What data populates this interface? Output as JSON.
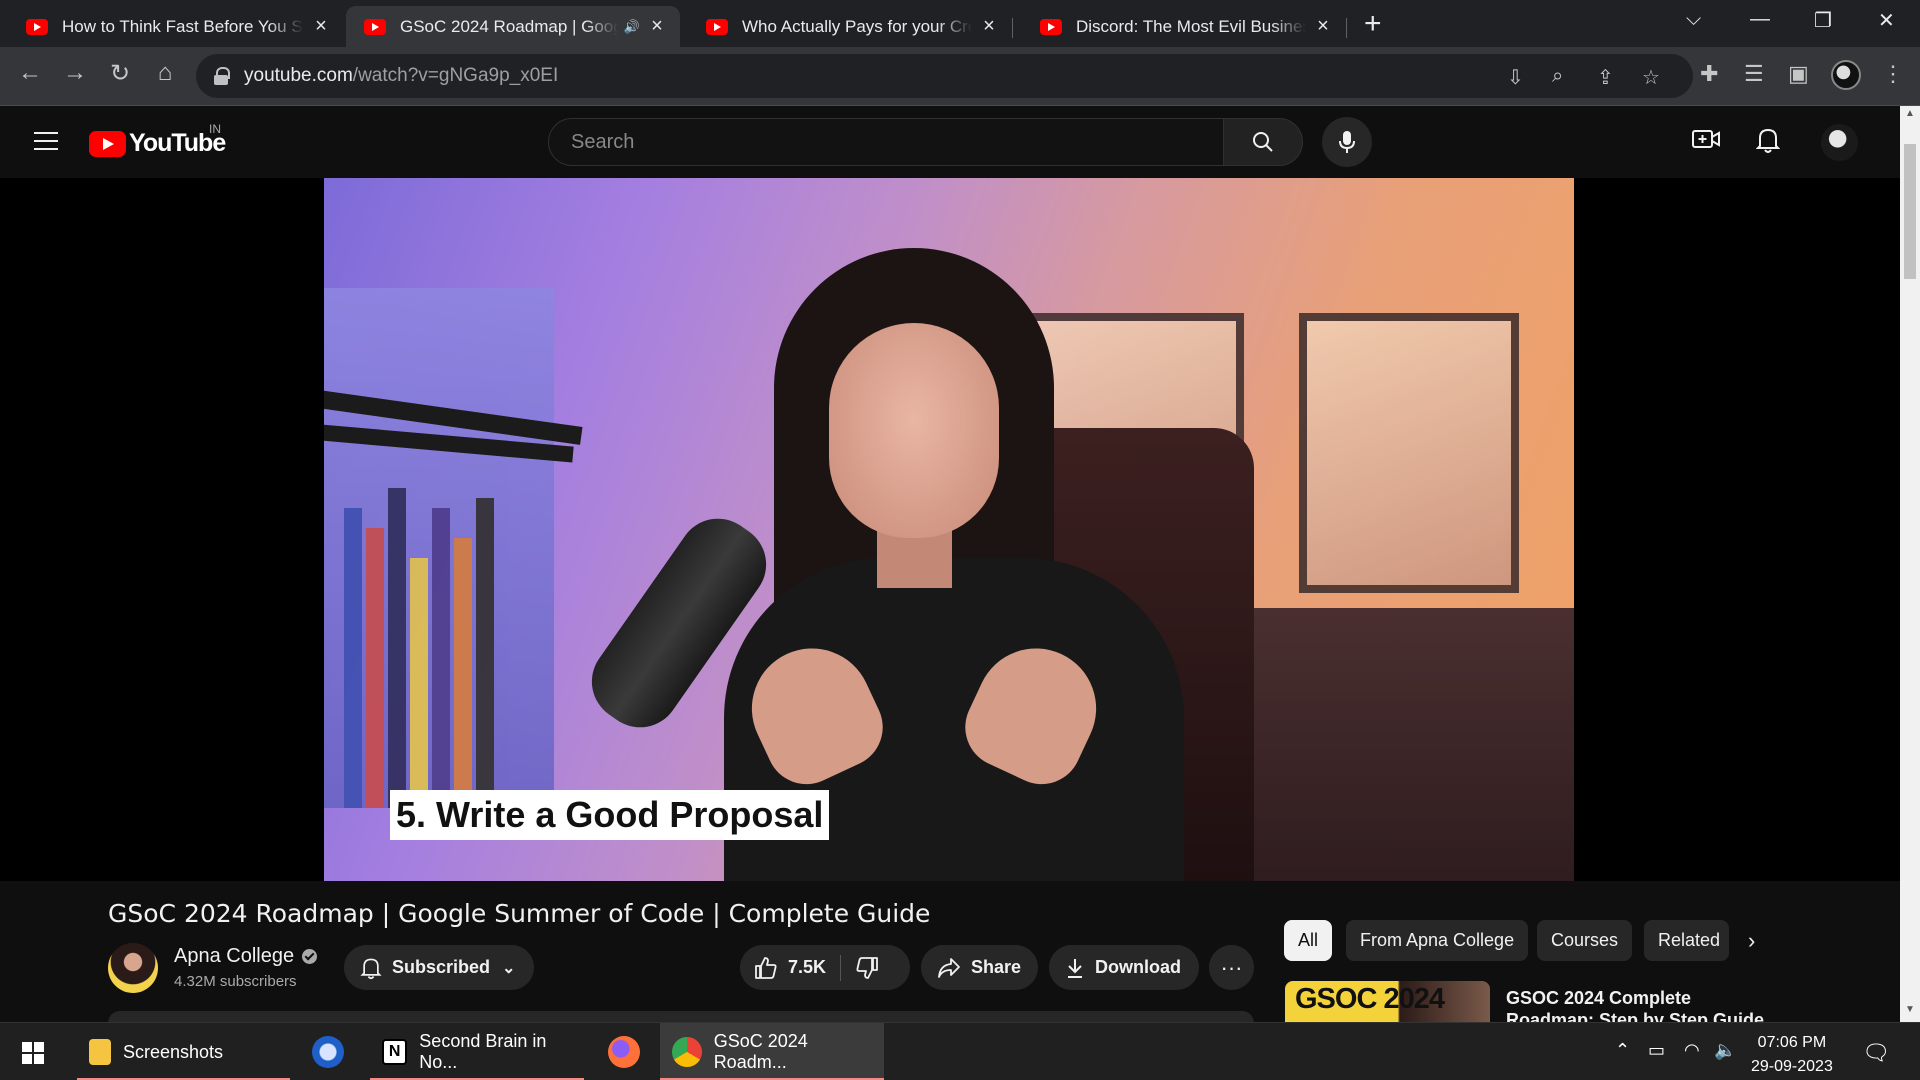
{
  "browser": {
    "tabs": [
      {
        "title": "How to Think Fast Before You Sp",
        "active": false
      },
      {
        "title": "GSoC 2024 Roadmap | Goog",
        "active": true,
        "audio": "🔊"
      },
      {
        "title": "Who Actually Pays for your Cred",
        "active": false
      },
      {
        "title": "Discord: The Most Evil Business I",
        "active": false
      }
    ],
    "new_tab": "+",
    "url_host": "youtube.com",
    "url_path": "/watch?v=gNGa9p_x0EI",
    "window_controls": {
      "minimize": "—",
      "restore": "❐",
      "close": "✕",
      "tab_search": "⌵"
    }
  },
  "youtube": {
    "logo_text": "YouTube",
    "country_code": "IN",
    "search_placeholder": "Search",
    "video": {
      "caption": "5. Write a Good Proposal",
      "title": "GSoC 2024 Roadmap | Google Summer of Code | Complete Guide"
    },
    "channel": {
      "name": "Apna College",
      "subscribers": "4.32M subscribers",
      "subscribe_label": "Subscribed"
    },
    "actions": {
      "likes": "7.5K",
      "share": "Share",
      "download": "Download",
      "more": "···"
    },
    "chips": [
      "All",
      "From Apna College",
      "Courses",
      "Related"
    ],
    "recommended": {
      "thumb_text": "GSOC 2024",
      "title": "GSOC 2024 Complete Roadmap: Step by Step Guide"
    }
  },
  "taskbar": {
    "apps": [
      {
        "label": "Screenshots"
      },
      {
        "label": "Second Brain in No..."
      },
      {
        "label": "GSoC 2024 Roadm..."
      }
    ],
    "time": "07:06 PM",
    "date": "29-09-2023"
  },
  "colors": {
    "yt_red": "#ff0000",
    "bg": "#0f0f0f",
    "chip_bg": "#272727",
    "chrome_toolbar": "#35363a",
    "chrome_tabstrip": "#202124"
  }
}
